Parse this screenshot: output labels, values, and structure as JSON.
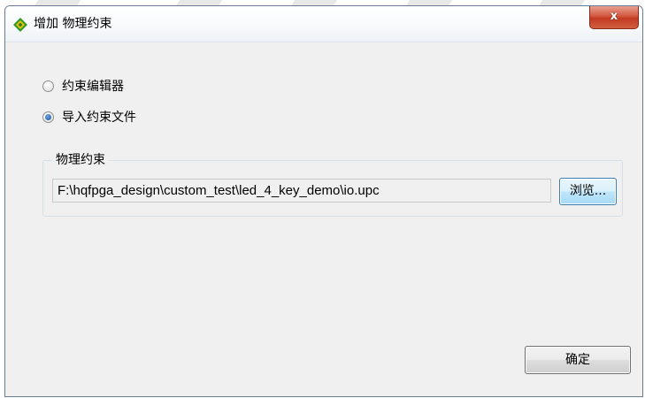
{
  "window": {
    "title": "增加 物理约束",
    "close_label": "x"
  },
  "options": {
    "editor_label": "约束编辑器",
    "import_label": "导入约束文件",
    "selected": "import"
  },
  "group": {
    "legend": "物理约束",
    "path_value": "F:\\hqfpga_design\\custom_test\\led_4_key_demo\\io.upc",
    "browse_label": "浏览..."
  },
  "footer": {
    "ok_label": "确定"
  },
  "colors": {
    "icon_green": "#2e9a2e",
    "icon_yellow": "#f2c200",
    "close_red": "#c9452b",
    "browse_blue": "#bee6fd"
  },
  "icons": {
    "app": "diamond-logo-icon"
  }
}
